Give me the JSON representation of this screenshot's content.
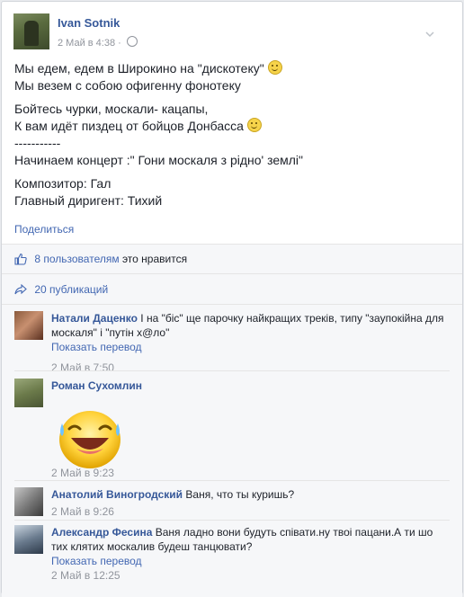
{
  "post": {
    "author": "Ivan Sotnik",
    "timestamp": "2 Май в 4:38",
    "separator": "·",
    "lines": [
      "Мы едем, едем в Широкино на \"дискотеку\"",
      "Мы везем с собою офигенну фонотеку",
      "Бойтесь чурки, москали- кацапы,",
      "К вам идёт пиздец от бойцов Донбасса",
      "-----------",
      "Начинаем концерт :\" Гони москаля з рідно' землі\"",
      "Композитор: Гал",
      "Главный диригент: Тихий"
    ],
    "share_label": "Поделиться"
  },
  "stats": {
    "likes_link": "8 пользователям",
    "likes_suffix": "это нравится",
    "shares": "20 публикаций"
  },
  "comments": [
    {
      "name": "Натали Даценко",
      "text": "І на \"біс\" ще парочку найкращих треків, типу \"заупокійна для москаля\" і \"путін х@ло\"",
      "translate": "Показать перевод",
      "time": "2 Май в 7:50"
    },
    {
      "name": "Роман Сухомлин",
      "text": "",
      "time": "2 Май в 9:23"
    },
    {
      "name": "Анатолий Виногродский",
      "text": "Ваня, что ты куришь?",
      "time": "2 Май в 9:26"
    },
    {
      "name": "Александр Фесина",
      "text": "Ваня ладно вони будуть співати.ну твоі пацани.А ти шо тих клятих москалив будеш танцювати?",
      "translate": "Показать перевод",
      "time": "2 Май в 12:25"
    }
  ],
  "icons": {
    "like": "thumbs-up-icon",
    "share": "share-arrow-icon",
    "privacy": "globe-icon",
    "menu": "chevron-down-icon"
  },
  "colors": {
    "link": "#365899",
    "accent": "#4267b2",
    "muted": "#90949c"
  }
}
